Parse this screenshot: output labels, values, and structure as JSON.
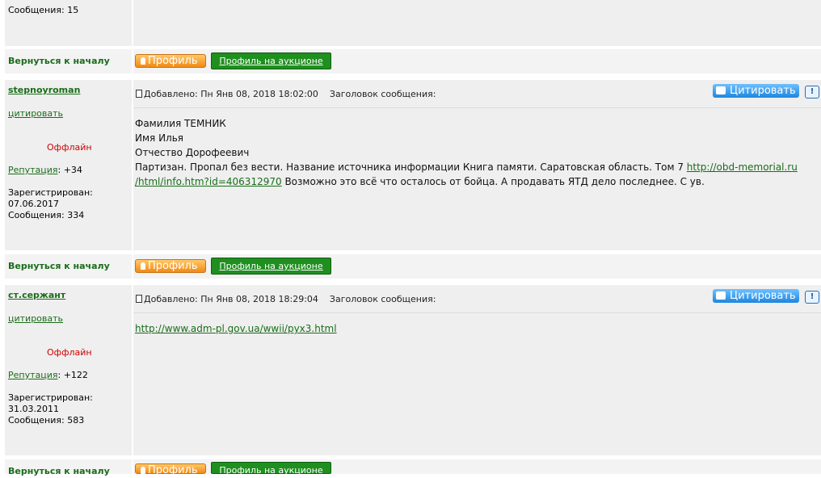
{
  "prev_post": {
    "messages": "Сообщения: 15"
  },
  "nav": {
    "back_to_top": "Вернуться к началу",
    "profile": "Профиль",
    "profile_auction": "Профиль на аукционе"
  },
  "posts": [
    {
      "username": "stepnoyroman",
      "quote_link": "цитировать",
      "status": "Оффлайн",
      "reputation_label": "Репутация",
      "reputation_value": ": +34",
      "registered_label": "Зарегистрирован:",
      "registered_date": "07.06.2017",
      "messages": "Сообщения: 334",
      "added": "Добавлено: Пн Янв 08, 2018 18:02:00",
      "subject_label": "Заголовок сообщения:",
      "cite_label": "Цитировать",
      "warn": "!",
      "lines": [
        "Фамилия ТЕМНИК",
        "Имя Илья",
        "Отчество Дорофеевич"
      ],
      "line4_a": "Партизан. Пропал без вести. Название источника информации Книга памяти. Саратовская область. Том 7 ",
      "link1": "http://obd-memorial.ru",
      "link2": "/html/info.htm?id=406312970",
      "line5_b": " Возможно это всё что осталось от бойца. А продавать ЯТД дело последнее. С ув."
    },
    {
      "username": "ст.сержант",
      "quote_link": "цитировать",
      "status": "Оффлайн",
      "reputation_label": "Репутация",
      "reputation_value": ": +122",
      "registered_label": "Зарегистрирован:",
      "registered_date": "31.03.2011",
      "messages": "Сообщения: 583",
      "added": "Добавлено: Пн Янв 08, 2018 18:29:04",
      "subject_label": "Заголовок сообщения:",
      "cite_label": "Цитировать",
      "warn": "!",
      "link": "http://www.adm-pl.gov.ua/wwii/pyx3.html"
    }
  ]
}
